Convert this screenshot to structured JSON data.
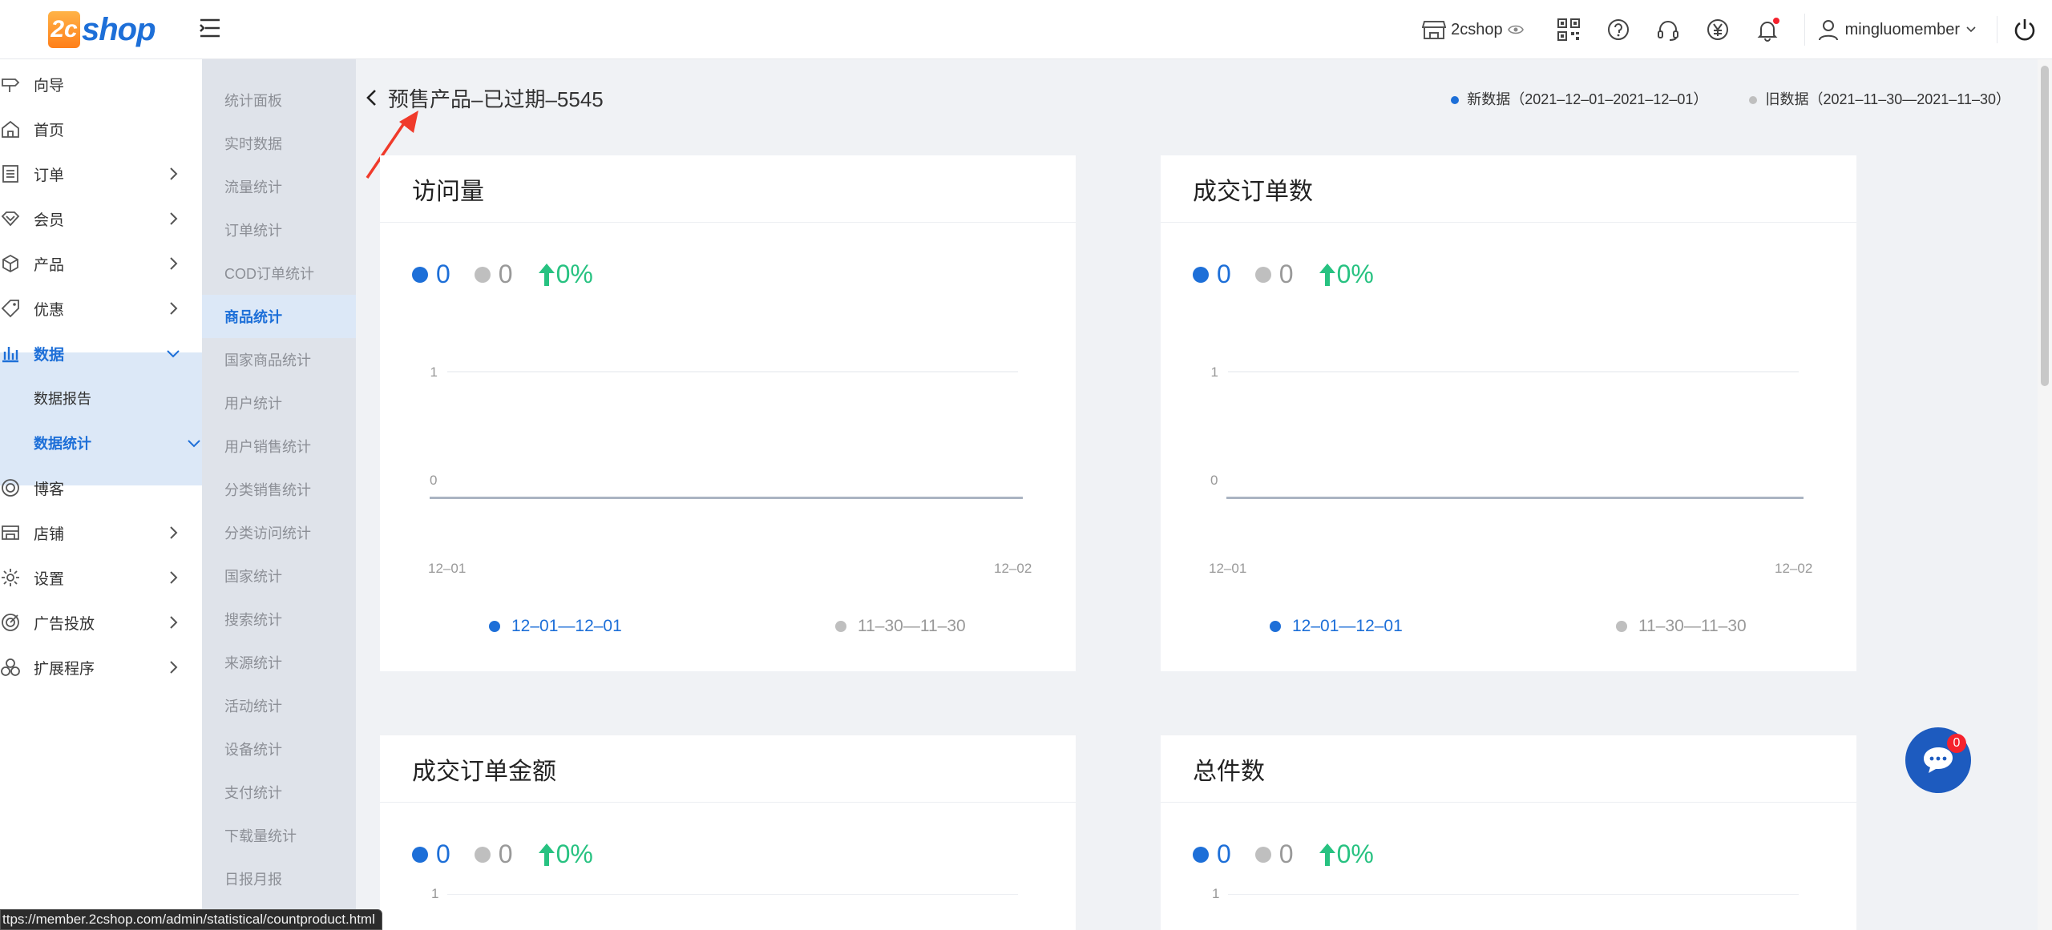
{
  "header": {
    "logo_badge": "2c",
    "logo_word": "shop",
    "shop_name": "2cshop",
    "user_name": "mingluomember",
    "icons": [
      "store-icon",
      "eye-icon",
      "qrcode-icon",
      "help-icon",
      "headset-icon",
      "yen-icon",
      "bell-icon",
      "user-icon",
      "power-icon"
    ]
  },
  "sidebar": {
    "items": [
      {
        "label": "向导",
        "icon": "signpost-icon"
      },
      {
        "label": "首页",
        "icon": "home-icon"
      },
      {
        "label": "订单",
        "icon": "order-icon"
      },
      {
        "label": "会员",
        "icon": "member-icon"
      },
      {
        "label": "产品",
        "icon": "box-icon"
      },
      {
        "label": "优惠",
        "icon": "tag-icon"
      },
      {
        "label": "数据",
        "icon": "bar-chart-icon"
      },
      {
        "label": "博客",
        "icon": "blog-icon"
      },
      {
        "label": "店铺",
        "icon": "shop-icon"
      },
      {
        "label": "设置",
        "icon": "gear-icon"
      },
      {
        "label": "广告投放",
        "icon": "target-icon"
      },
      {
        "label": "扩展程序",
        "icon": "extension-icon"
      }
    ],
    "sub_items": [
      {
        "label": "数据报告"
      },
      {
        "label": "数据统计"
      }
    ]
  },
  "subnav": {
    "items": [
      "统计面板",
      "实时数据",
      "流量统计",
      "订单统计",
      "COD订单统计",
      "商品统计",
      "国家商品统计",
      "用户统计",
      "用户销售统计",
      "分类销售统计",
      "分类访问统计",
      "国家统计",
      "搜索统计",
      "来源统计",
      "活动统计",
      "设备统计",
      "支付统计",
      "下载量统计",
      "日报月报"
    ],
    "active": "商品统计"
  },
  "page": {
    "title": "预售产品–已过期–5545",
    "legend_new": "新数据（2021–12–01–2021–12–01）",
    "legend_old": "旧数据（2021–11–30—2021–11–30）"
  },
  "cards": [
    {
      "title": "访问量",
      "new_value": "0",
      "old_value": "0",
      "change": "0%",
      "y_top": "1",
      "y_bottom": "0",
      "x_start": "12–01",
      "x_end": "12–02",
      "legend_new": "12–01—12–01",
      "legend_old": "11–30—11–30"
    },
    {
      "title": "成交订单数",
      "new_value": "0",
      "old_value": "0",
      "change": "0%",
      "y_top": "1",
      "y_bottom": "0",
      "x_start": "12–01",
      "x_end": "12–02",
      "legend_new": "12–01—12–01",
      "legend_old": "11–30—11–30"
    },
    {
      "title": "成交订单金额",
      "new_value": "0",
      "old_value": "0",
      "change": "0%",
      "y_top": "1"
    },
    {
      "title": "总件数",
      "new_value": "0",
      "old_value": "0",
      "change": "0%",
      "y_top": "1"
    }
  ],
  "colors": {
    "new": "#1d6fd8",
    "old": "#bfbfbf",
    "up": "#27c281"
  },
  "chat": {
    "count": "0"
  },
  "status_url": "ttps://member.2cshop.com/admin/statistical/countproduct.html"
}
